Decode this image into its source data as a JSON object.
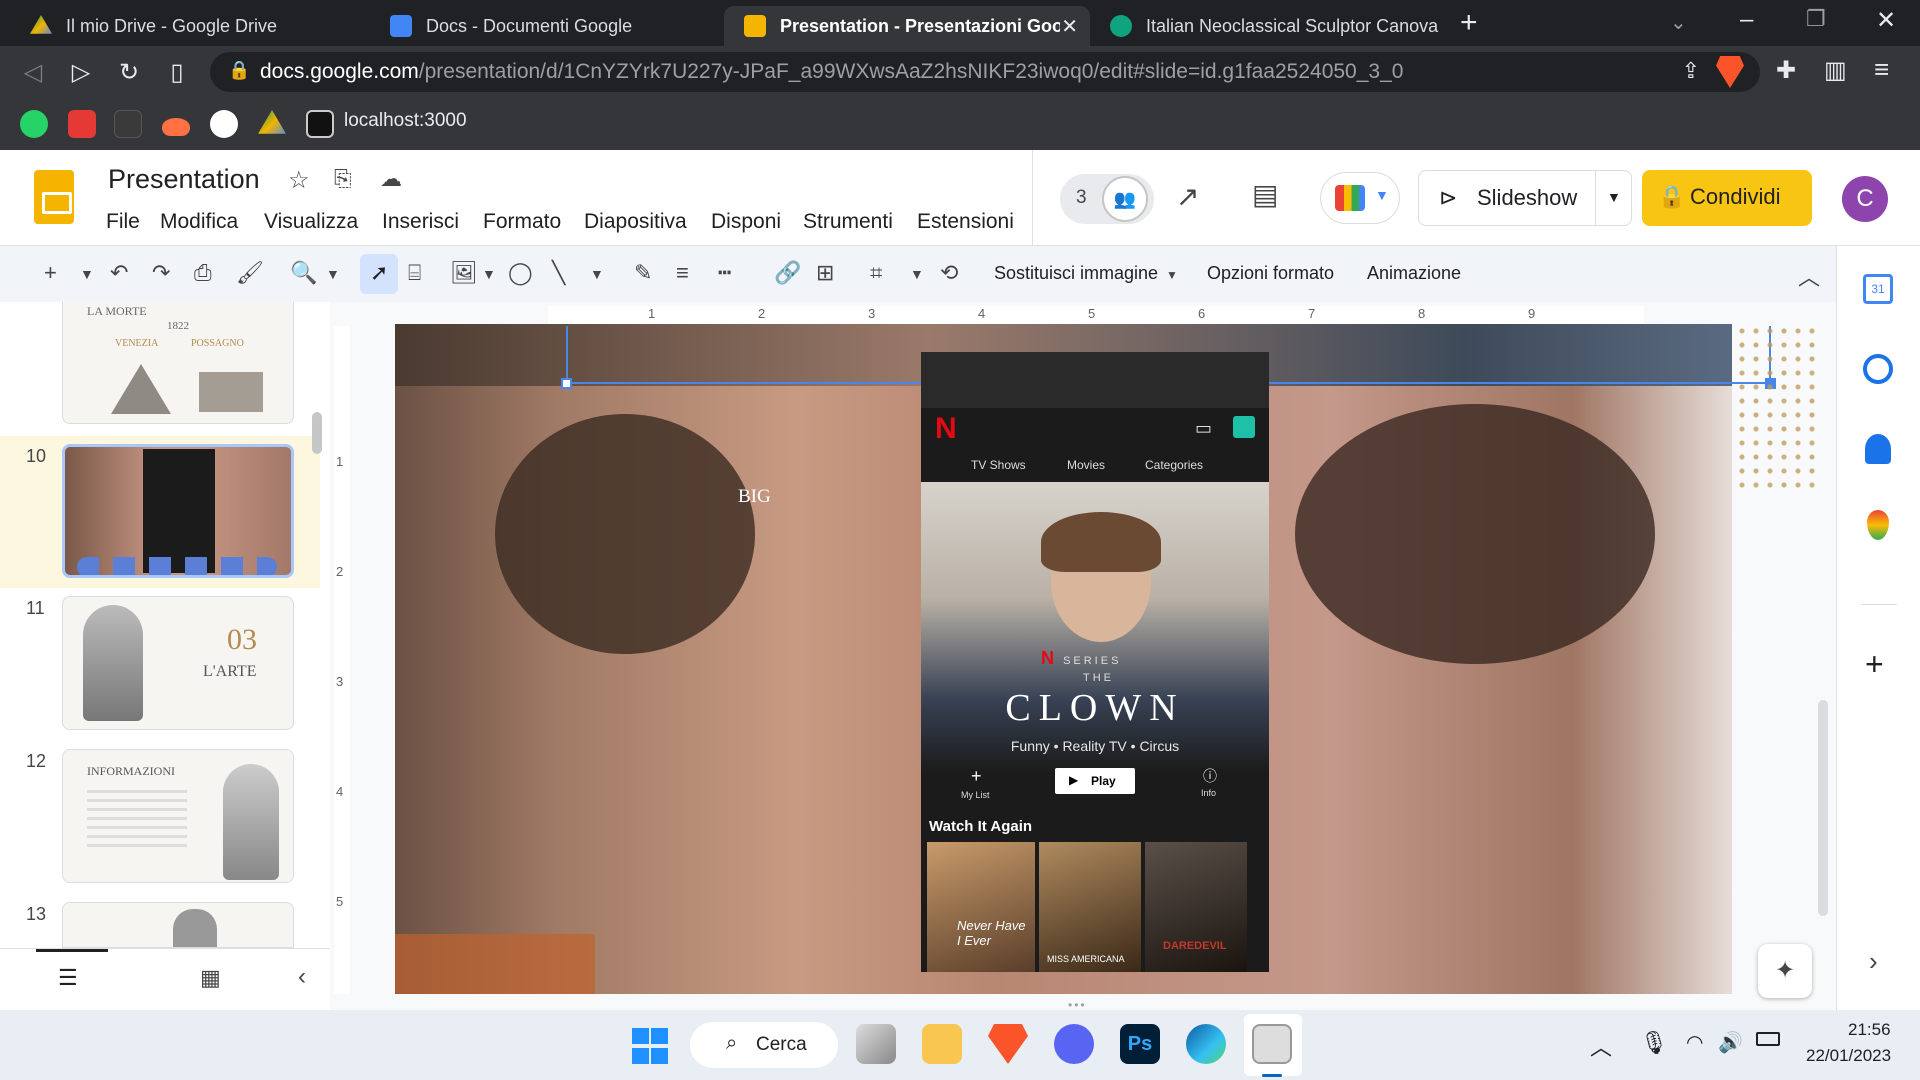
{
  "browser": {
    "tabs": [
      {
        "title": "Il mio Drive - Google Drive",
        "active": false
      },
      {
        "title": "Docs - Documenti Google",
        "active": false
      },
      {
        "title": "Presentation - Presentazioni Goo",
        "active": true
      },
      {
        "title": "Italian Neoclassical Sculptor Canova",
        "active": false
      }
    ],
    "url_host": "docs.google.com",
    "url_path": "/presentation/d/1CnYZYrk7U227y-JPaF_a99WXwsAaZ2hsNIKF23iwoq0/edit#slide=id.g1faa2524050_3_0",
    "bookmark_localhost": "localhost:3000"
  },
  "app": {
    "title": "Presentation",
    "menus": [
      "File",
      "Modifica",
      "Visualizza",
      "Inserisci",
      "Formato",
      "Diapositiva",
      "Disponi",
      "Strumenti",
      "Estensioni"
    ],
    "collaborators_count": "3",
    "slideshow_label": "Slideshow",
    "share_label": "Condividi",
    "avatar_initial": "C",
    "accent": "#f9c513"
  },
  "toolbar": {
    "replace_image": "Sostituisci immagine",
    "format_options": "Opzioni formato",
    "animation": "Animazione"
  },
  "filmstrip": {
    "slides": [
      {
        "num": "10",
        "label": ""
      },
      {
        "num": "11",
        "label": "03",
        "sublabel": "L'ARTE"
      },
      {
        "num": "12",
        "label": "INFORMAZIONI"
      },
      {
        "num": "13",
        "label": ""
      }
    ],
    "top_thumb": {
      "label": "LA MORTE",
      "year": "1822",
      "left": "VENEZIA",
      "right": "POSSAGNO"
    }
  },
  "ruler": {
    "h_ticks": [
      "1",
      "2",
      "3",
      "4",
      "5",
      "6",
      "7",
      "8",
      "9"
    ],
    "v_ticks": [
      "1",
      "2",
      "3",
      "4",
      "5"
    ]
  },
  "slide": {
    "big_text": "BIG",
    "phone": {
      "tabs": [
        "TV Shows",
        "Movies",
        "Categories"
      ],
      "series_label": "SERIES",
      "the": "THE",
      "show_title": "CLOWN",
      "genres": "Funny • Reality TV • Circus",
      "my_list": "My List",
      "play": "Play",
      "info": "Info",
      "row_title": "Watch It Again",
      "posters": [
        "Never Have I Ever",
        "MISS AMERICANA",
        "DAREDEVIL"
      ]
    }
  },
  "taskbar": {
    "search": "Cerca",
    "time": "21:56",
    "date": "22/01/2023"
  }
}
